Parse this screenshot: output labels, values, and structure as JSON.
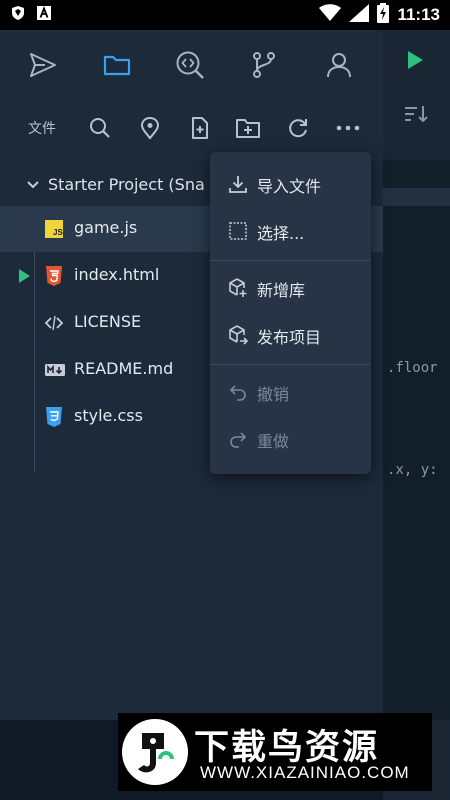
{
  "status_bar": {
    "time": "11:13"
  },
  "toolbar": {
    "files_label": "文件"
  },
  "project": {
    "name": "Starter Project (Sna"
  },
  "files": [
    {
      "name": "game.js",
      "icon": "js-file-icon"
    },
    {
      "name": "index.html",
      "icon": "html-file-icon"
    },
    {
      "name": "LICENSE",
      "icon": "code-file-icon"
    },
    {
      "name": "README.md",
      "icon": "markdown-file-icon"
    },
    {
      "name": "style.css",
      "icon": "css-file-icon"
    }
  ],
  "menu": {
    "items": [
      {
        "label": "导入文件",
        "icon": "download-icon"
      },
      {
        "label": "选择...",
        "icon": "checkbox-icon"
      },
      {
        "label": "新增库",
        "icon": "add-package-icon"
      },
      {
        "label": "发布项目",
        "icon": "publish-package-icon"
      },
      {
        "label": "撤销",
        "icon": "undo-icon"
      },
      {
        "label": "重做",
        "icon": "redo-icon"
      }
    ]
  },
  "editor": {
    "snippets": [
      ".floor",
      ".x, y:"
    ]
  },
  "watermark": {
    "title": "下载鸟资源",
    "url": "WWW.XIAZAINIAO.COM"
  },
  "colors": {
    "accent": "#3aa0f0",
    "run_green": "#2ec27e",
    "js": "#f0d43a",
    "html": "#e4572e",
    "css": "#3aa0f0"
  }
}
